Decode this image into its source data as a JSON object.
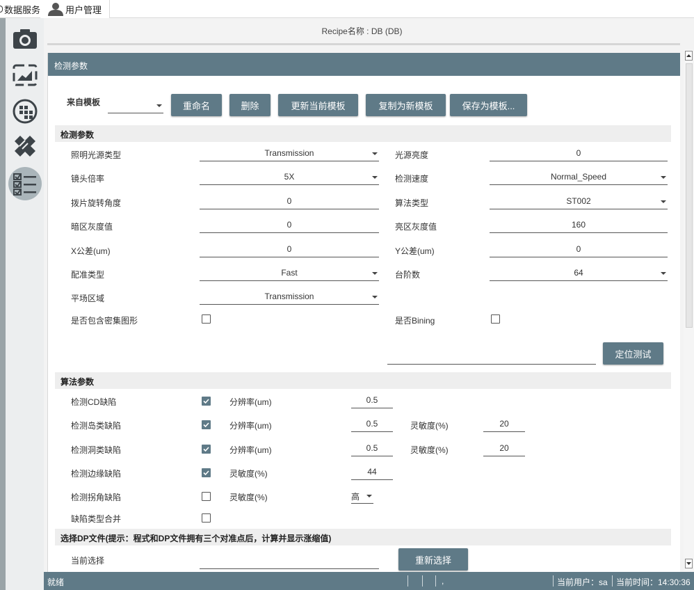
{
  "tabs": [
    {
      "label": "数据服务",
      "icon": "database-icon"
    },
    {
      "label": "用户管理",
      "icon": "user-icon"
    }
  ],
  "sidebar": [
    {
      "icon": "camera-icon"
    },
    {
      "icon": "image-chart-icon"
    },
    {
      "icon": "wafer-icon"
    },
    {
      "icon": "ruler-pencil-icon"
    },
    {
      "icon": "checklist-icon",
      "selected": true
    }
  ],
  "recipe_title": "Recipe名称 : DB (DB)",
  "panel_title": "检测参数",
  "template": {
    "label": "来自模板",
    "value": "",
    "buttons": [
      "重命名",
      "删除",
      "更新当前模板",
      "复制为新模板",
      "保存为模板..."
    ]
  },
  "detection": {
    "title": "检测参数",
    "left": [
      {
        "label": "照明光源类型",
        "value": "Transmission",
        "type": "combo"
      },
      {
        "label": "镜头倍率",
        "value": "5X",
        "type": "combo"
      },
      {
        "label": "拨片旋转角度",
        "value": "0",
        "type": "text"
      },
      {
        "label": "暗区灰度值",
        "value": "0",
        "type": "text"
      },
      {
        "label": "X公差(um)",
        "value": "0",
        "type": "text"
      },
      {
        "label": "配准类型",
        "value": "Fast",
        "type": "combo"
      },
      {
        "label": "平场区域",
        "value": "Transmission",
        "type": "combo"
      }
    ],
    "right": [
      {
        "label": "光源亮度",
        "value": "0",
        "type": "text"
      },
      {
        "label": "检测速度",
        "value": "Normal_Speed",
        "type": "combo"
      },
      {
        "label": "算法类型",
        "value": "ST002",
        "type": "combo"
      },
      {
        "label": "亮区灰度值",
        "value": "160",
        "type": "text"
      },
      {
        "label": "Y公差(um)",
        "value": "0",
        "type": "text"
      },
      {
        "label": "台阶数",
        "value": "64",
        "type": "combo"
      }
    ],
    "dense_pattern_label": "是否包含密集图形",
    "dense_pattern_checked": false,
    "binning_label": "是否Bining",
    "binning_checked": false,
    "locate_value": "",
    "locate_button": "定位测试"
  },
  "algorithm": {
    "title": "算法参数",
    "rows": [
      {
        "label": "检测CD缺陷",
        "checked": true,
        "p1_label": "分辨率(um)",
        "p1_value": "0.5",
        "p2_label": "",
        "p2_value": ""
      },
      {
        "label": "检测岛类缺陷",
        "checked": true,
        "p1_label": "分辨率(um)",
        "p1_value": "0.5",
        "p2_label": "灵敏度(%)",
        "p2_value": "20"
      },
      {
        "label": "检测洞类缺陷",
        "checked": true,
        "p1_label": "分辨率(um)",
        "p1_value": "0.5",
        "p2_label": "灵敏度(%)",
        "p2_value": "20"
      },
      {
        "label": "检测边缘缺陷",
        "checked": true,
        "p1_label": "灵敏度(%)",
        "p1_value": "44",
        "p2_label": "",
        "p2_value": ""
      },
      {
        "label": "检测拐角缺陷",
        "checked": false,
        "p1_label": "灵敏度(%)",
        "p1_value": "高",
        "p2_label": "",
        "p2_value": ""
      },
      {
        "label": "缺陷类型合并",
        "checked": false,
        "p1_label": "",
        "p1_value": "",
        "p2_label": "",
        "p2_value": ""
      }
    ]
  },
  "dp_file": {
    "title": "选择DP文件(提示：程式和DP文件拥有三个对准点后，计算并显示涨缩值)",
    "current_label": "当前选择",
    "current_value": "",
    "reselect_button": "重新选择"
  },
  "status": {
    "ready": "就绪",
    "dot": ",",
    "user": "当前用户：sa",
    "time": "当前时间：14:30:36"
  },
  "colors": {
    "accent": "#5f7a87",
    "sidebar_bg": "#eceeef",
    "section_bg": "#eeeeee"
  }
}
